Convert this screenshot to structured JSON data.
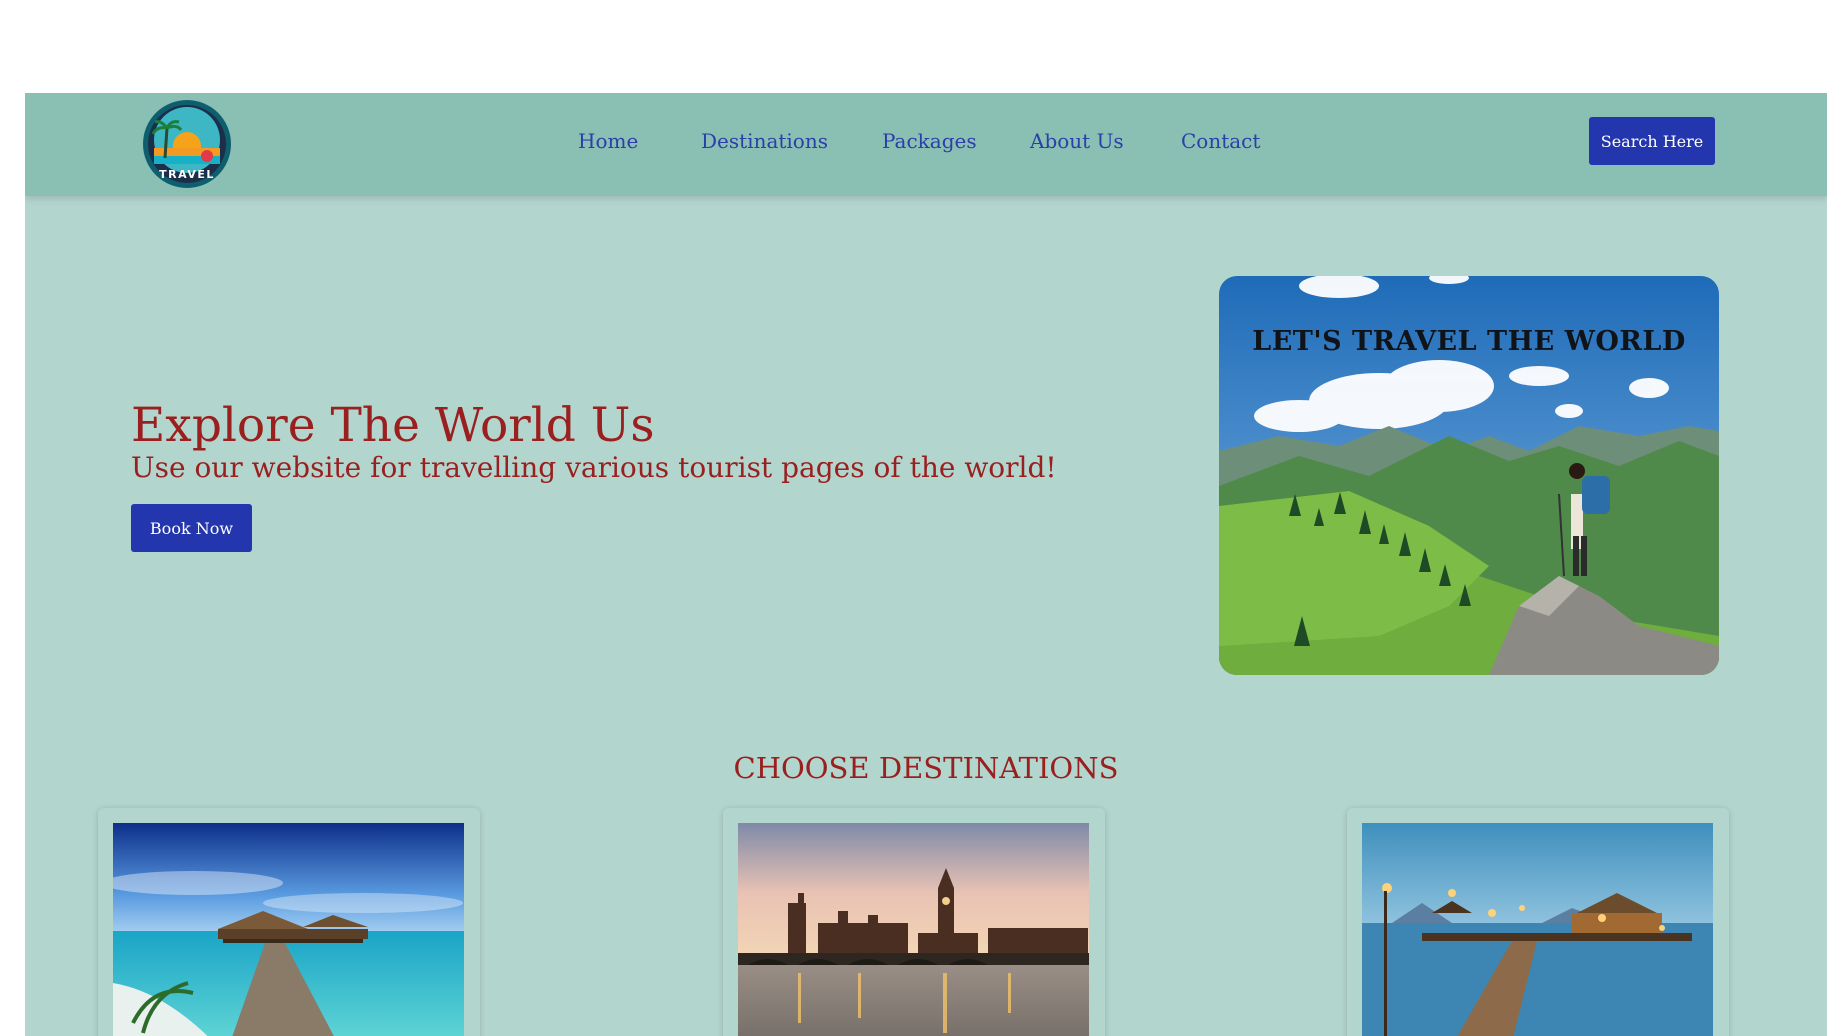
{
  "nav": {
    "logo_alt": "TRAVEL",
    "links": [
      "Home",
      "Destinations",
      "Packages",
      "About Us",
      "Contact"
    ],
    "search_label": "Search Here"
  },
  "hero": {
    "title": "Explore The World Us",
    "subtitle": "Use our website for travelling various tourist pages of the world!",
    "cta_label": "Book Now",
    "image_caption": "LET'S TRAVEL THE WORLD"
  },
  "destinations": {
    "section_title": "CHOOSE DESTINATIONS",
    "cards": [
      {
        "image": "maldives-overwater-villas"
      },
      {
        "image": "london-westminster-bridge"
      },
      {
        "image": "tropical-pier-at-dusk"
      }
    ]
  },
  "colors": {
    "navbar_bg": "#8abfb3",
    "page_bg": "#b2d5cd",
    "button_bg": "#2336ad",
    "heading_red": "#9a1f1f",
    "nav_link": "#2a3fa8"
  }
}
